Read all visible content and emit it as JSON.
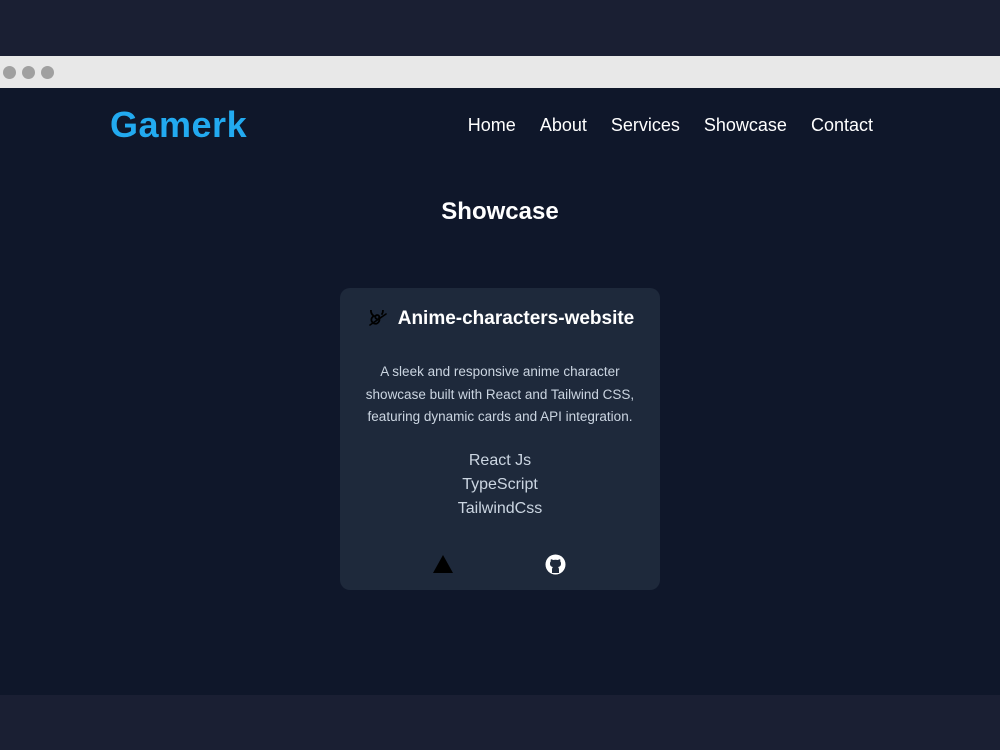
{
  "header": {
    "logo": "Gamerk",
    "nav": [
      "Home",
      "About",
      "Services",
      "Showcase",
      "Contact"
    ]
  },
  "section": {
    "title": "Showcase"
  },
  "project": {
    "icon": "leaf-village-swirl-icon",
    "title": "Anime-characters-website",
    "description": "A sleek and responsive anime character showcase built with React and Tailwind CSS, featuring dynamic cards and API integration.",
    "tech": [
      "React Js",
      "TypeScript",
      "TailwindCss"
    ],
    "links": [
      "vercel-icon",
      "github-icon"
    ]
  },
  "colors": {
    "page_bg": "#0f172a",
    "card_bg": "#1e293b",
    "accent": "#22aaf0",
    "outer_bg": "#1a1f33"
  }
}
